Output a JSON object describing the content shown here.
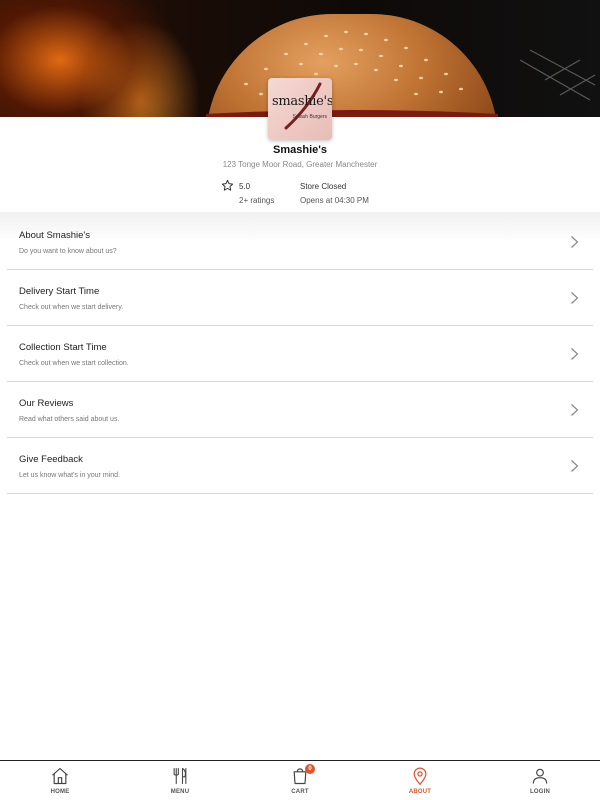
{
  "store": {
    "logo_text": "smashie's",
    "logo_subtext": "Smash Burgers",
    "name": "Smashie's",
    "address": "123 Tonge Moor Road, Greater Manchester",
    "rating": "5.0",
    "ratings_count": "2+ ratings",
    "status": "Store Closed",
    "opens": "Opens at 04:30 PM"
  },
  "menu": {
    "items": [
      {
        "title": "About Smashie's",
        "subtitle": "Do you want to know about us?"
      },
      {
        "title": "Delivery Start Time",
        "subtitle": "Check out when we start delivery."
      },
      {
        "title": "Collection Start Time",
        "subtitle": "Check out when we start collection."
      },
      {
        "title": "Our Reviews",
        "subtitle": "Read what others said about us."
      },
      {
        "title": "Give Feedback",
        "subtitle": "Let us know what's in your mind."
      }
    ]
  },
  "nav": {
    "items": [
      {
        "label": "HOME",
        "icon": "home-icon"
      },
      {
        "label": "MENU",
        "icon": "cutlery-icon"
      },
      {
        "label": "CART",
        "icon": "shopping-bag-icon"
      },
      {
        "label": "ABOUT",
        "icon": "location-pin-icon"
      },
      {
        "label": "LOGIN",
        "icon": "user-icon"
      }
    ],
    "active": "ABOUT",
    "cart_count": "0"
  },
  "colors": {
    "accent": "#e2542c",
    "divider": "#dcdcdc",
    "text_muted": "#888888"
  }
}
